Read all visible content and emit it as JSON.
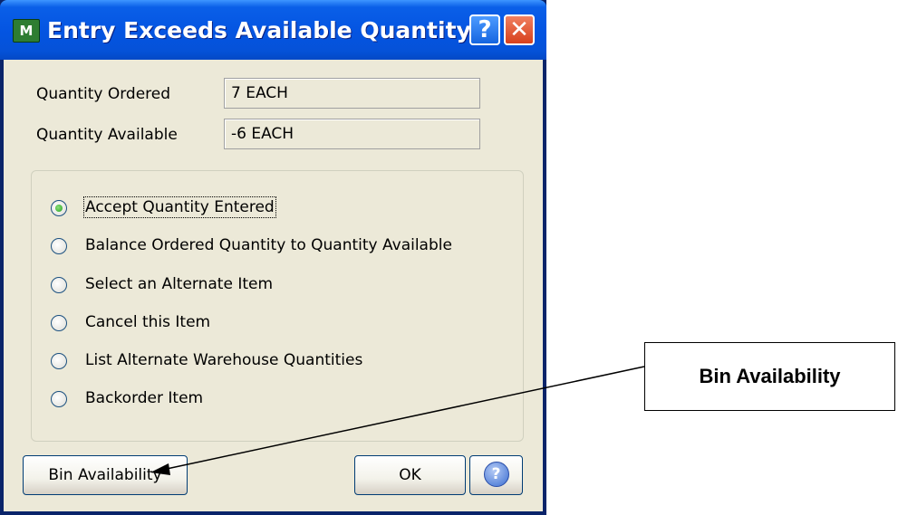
{
  "dialog": {
    "title": "Entry Exceeds Available Quantity",
    "app_icon": "mas-app-icon",
    "help_button_glyph": "?",
    "close_button_glyph": "✕"
  },
  "fields": {
    "quantity_ordered": {
      "label": "Quantity Ordered",
      "value": "7 EACH"
    },
    "quantity_available": {
      "label": "Quantity Available",
      "value": "-6 EACH"
    }
  },
  "options": [
    {
      "label": "Accept Quantity Entered",
      "checked": true
    },
    {
      "label": "Balance Ordered Quantity to Quantity Available",
      "checked": false
    },
    {
      "label": "Select an Alternate Item",
      "checked": false
    },
    {
      "label": "Cancel this Item",
      "checked": false
    },
    {
      "label": "List Alternate Warehouse Quantities",
      "checked": false
    },
    {
      "label": "Backorder Item",
      "checked": false
    }
  ],
  "buttons": {
    "bin_availability": "Bin Availability",
    "ok": "OK",
    "help_glyph": "?"
  },
  "callout": {
    "text": "Bin Availability"
  }
}
